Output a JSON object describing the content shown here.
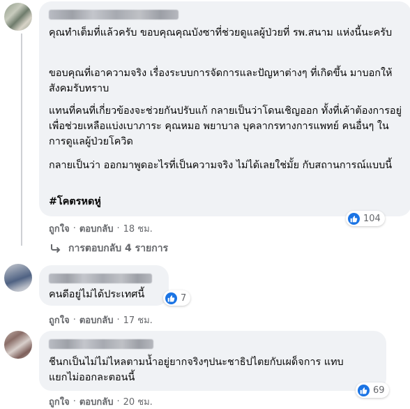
{
  "comments": [
    {
      "paragraphs": [
        "คุณทำเต็มที่แล้วครับ ขอบคุณคุณบังซาที่ช่วยดูแลผู้ป่วยที่ รพ.สนาม แห่งนี้นะครับ",
        "ขอบคุณที่เอาความจริง เรื่องระบบการจัดการและปัญหาต่างๆ ที่เกิดขึ้น มาบอกให้สังคมรับทราบ",
        "แทนที่คนที่เกี่ยวข้องจะช่วยกันปรับแก้ กลายเป็นว่าโดนเชิญออก ทั้งที่เค้าต้องการอยู่เพื่อช่วยเหลือแบ่งเบาภาระ คุณหมอ พยาบาล บุคลากรทางการแพทย์ คนอื่นๆ ในการดูแลผู้ป่วยโควิด",
        "กลายเป็นว่า ออกมาพูดอะไรที่เป็นความจริง ไม่ได้เลยใช่มั้ย กับสถานการณ์แบบนี้"
      ],
      "hashtag": "#โคตรหดหู่",
      "reaction_count": "104",
      "actions": {
        "like": "ถูกใจ",
        "reply": "ตอบกลับ",
        "time": "18 ชม."
      },
      "replies_label": "การตอบกลับ 4 รายการ"
    },
    {
      "paragraphs": [
        "คนดีอยู่ไม่ได้ประเทศนี้"
      ],
      "reaction_count": "7",
      "actions": {
        "like": "ถูกใจ",
        "reply": "ตอบกลับ",
        "time": "17 ชม."
      }
    },
    {
      "paragraphs": [
        "ชีนกเป็นไม่ไม่ไหลตามน้ำอยู่ยากจริงๆปนะชาธิปไตยกับเผด็จการ แทบแยกไม่ออกละตอนนี้"
      ],
      "reaction_count": "69",
      "actions": {
        "like": "ถูกใจ",
        "reply": "ตอบกลับ",
        "time": "20 ชม."
      }
    }
  ],
  "separator": "·",
  "icons": {
    "reaction": "like-icon",
    "replies": "reply-arrow-icon"
  },
  "colors": {
    "bubble": "#f0f2f5",
    "like_blue": "#1b74e4",
    "meta_text": "#65676b"
  }
}
